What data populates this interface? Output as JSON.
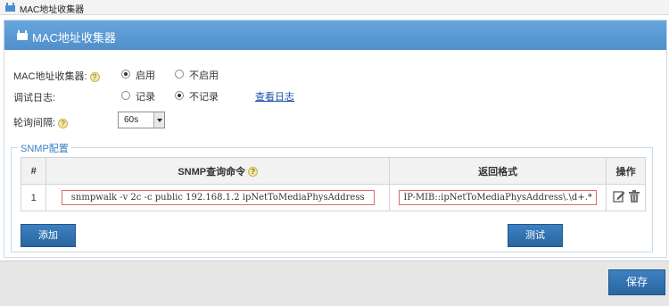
{
  "window": {
    "title": "MAC地址收集器"
  },
  "panel": {
    "title": "MAC地址收集器"
  },
  "form": {
    "collector": {
      "label": "MAC地址收集器:",
      "options": [
        {
          "label": "启用",
          "checked": true
        },
        {
          "label": "不启用",
          "checked": false
        }
      ]
    },
    "debug_log": {
      "label": "调试日志:",
      "options": [
        {
          "label": "记录",
          "checked": false
        },
        {
          "label": "不记录",
          "checked": true
        }
      ],
      "view_log_link": "查看日志"
    },
    "poll_interval": {
      "label": "轮询间隔:",
      "selected": "60s"
    }
  },
  "snmp": {
    "legend": "SNMP配置",
    "columns": [
      "#",
      "SNMP查询命令",
      "返回格式",
      "操作"
    ],
    "rows": [
      {
        "index": "1",
        "command": "snmpwalk -v 2c -c public 192.168.1.2 ipNetToMediaPhysAddress",
        "format": "IP-MIB::ipNetToMediaPhysAddress\\.\\d+.*"
      }
    ],
    "add_label": "添加",
    "test_label": "测试"
  },
  "footer": {
    "save_label": "保存"
  },
  "icons": {
    "help": "help-icon",
    "edit": "edit-icon",
    "delete": "trash-icon",
    "app": "app-icon"
  },
  "colors": {
    "header_blue": "#5b9bd5",
    "button_blue": "#2e6da4",
    "highlight_red": "#d86b6b",
    "link_blue": "#1a4ea8"
  }
}
